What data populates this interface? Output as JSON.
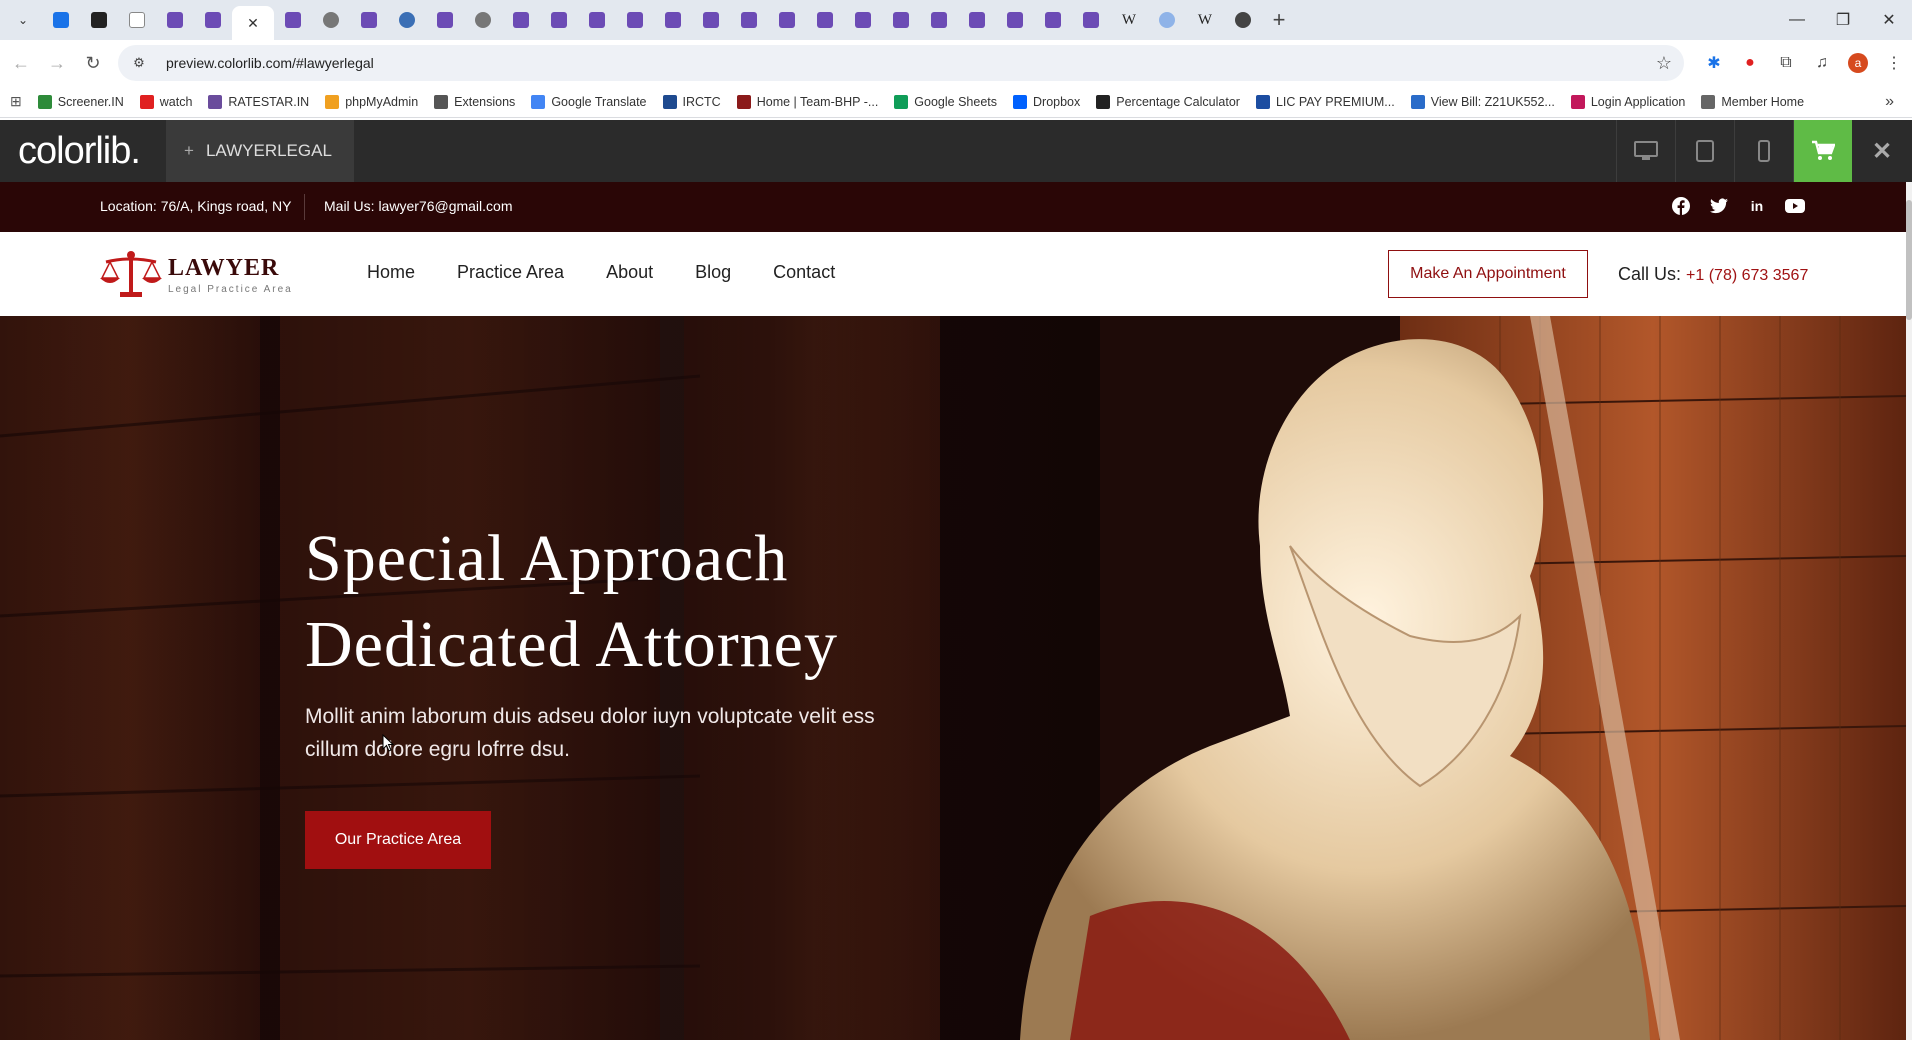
{
  "browser": {
    "tabs_count_note": "",
    "url": "preview.colorlib.com/#lawyerlegal",
    "tab_close": "✕",
    "new_tab": "+",
    "bookmarks": [
      {
        "label": "Screener.IN",
        "color": "#2e8b3a"
      },
      {
        "label": "watch",
        "color": "#e02020"
      },
      {
        "label": "RATESTAR.IN",
        "color": "#6a4c9c"
      },
      {
        "label": "phpMyAdmin",
        "color": "#f0a020"
      },
      {
        "label": "Extensions",
        "color": "#555555"
      },
      {
        "label": "Google Translate",
        "color": "#4285f4"
      },
      {
        "label": "IRCTC",
        "color": "#1e4a8f"
      },
      {
        "label": "Home | Team-BHP -...",
        "color": "#8b1a1a"
      },
      {
        "label": "Google Sheets",
        "color": "#0f9d58"
      },
      {
        "label": "Dropbox",
        "color": "#0061fe"
      },
      {
        "label": "Percentage Calculator",
        "color": "#222222"
      },
      {
        "label": "LIC PAY PREMIUM...",
        "color": "#1c4da1"
      },
      {
        "label": "View Bill: Z21UK552...",
        "color": "#2a6cc9"
      },
      {
        "label": "Login Application",
        "color": "#c2185b"
      },
      {
        "label": "Member Home",
        "color": "#666666"
      }
    ],
    "bookmarks_more": "»"
  },
  "preview": {
    "logo": "colorlib.",
    "theme_name": "LAWYERLEGAL",
    "plus": "+",
    "close": "✕"
  },
  "site": {
    "topbar": {
      "location": "Location: 76/A, Kings road, NY",
      "mail": "Mail Us: lawyer76@gmail.com",
      "social": [
        "facebook-icon",
        "twitter-icon",
        "linkedin-icon",
        "youtube-icon"
      ]
    },
    "logo": {
      "name": "LAWYER",
      "tagline": "Legal Practice Area"
    },
    "nav": [
      "Home",
      "Practice Area",
      "About",
      "Blog",
      "Contact"
    ],
    "appointment": "Make An Appointment",
    "call_label": "Call Us:",
    "call_number": "+1 (78) 673 3567",
    "hero": {
      "title_line1": "Special Approach",
      "title_line2": "Dedicated Attorney",
      "text": "Mollit anim laborum duis adseu dolor iuyn voluptcate velit ess cillum dolore egru lofrre dsu.",
      "button": "Our Practice Area"
    },
    "colors": {
      "brand": "#a10f10",
      "topbar": "#2a0606",
      "cart": "#5fbb46"
    }
  }
}
